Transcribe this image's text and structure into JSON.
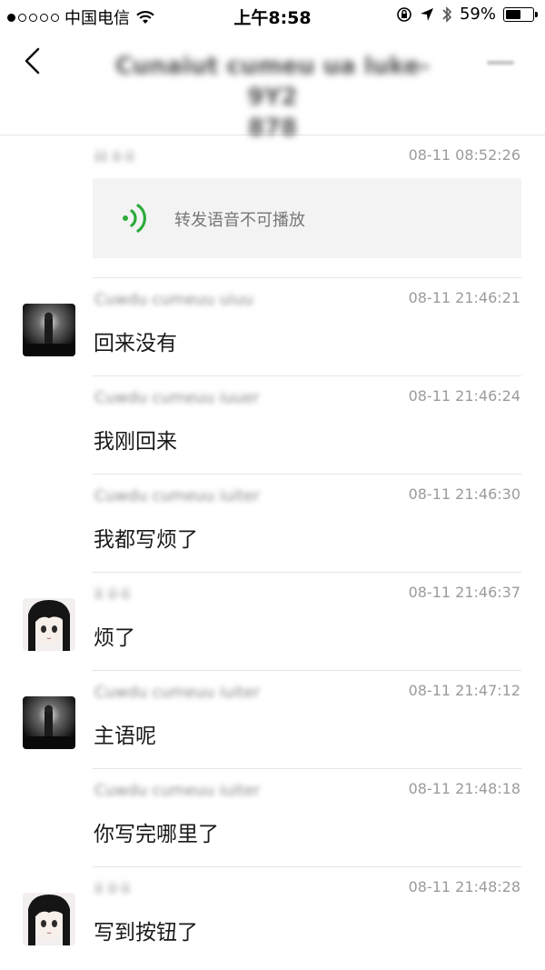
{
  "status_bar": {
    "signal_dots": 5,
    "signal_strength": 1,
    "carrier": "中国电信",
    "time": "上午8:58",
    "battery_text": "59%",
    "battery_level": 0.59,
    "icons": [
      "wifi-icon",
      "lock-rotation-icon",
      "location-arrow-icon",
      "bluetooth-icon",
      "battery-icon"
    ]
  },
  "header": {
    "title_line1": "Cunaiut cumeu ua luke-9Y2",
    "title_line2": "878",
    "back_icon": "chevron-left-icon",
    "more_icon": "more-icon"
  },
  "voice_message": {
    "sender": "iii ii·ii",
    "time": "08-11 08:52:26",
    "label": "转发语音不可播放",
    "icon": "voice-waves-icon",
    "icon_color": "#2bab3b"
  },
  "messages": [
    {
      "sender": "Cuwdu cumeuu uiuu",
      "time": "08-11 21:46:21",
      "text": "回来没有",
      "avatar": "dark"
    },
    {
      "sender": "Cuwdu cumeuu iuuer",
      "time": "08-11 21:46:24",
      "text": "我刚回来",
      "avatar": ""
    },
    {
      "sender": "Cuwdu cumeuu iuiter",
      "time": "08-11 21:46:30",
      "text": "我都写烦了",
      "avatar": ""
    },
    {
      "sender": "ii ii·ii",
      "time": "08-11 21:46:37",
      "text": "烦了",
      "avatar": "anime"
    },
    {
      "sender": "Cuwdu cumeuu iuiter",
      "time": "08-11 21:47:12",
      "text": "主语呢",
      "avatar": "dark"
    },
    {
      "sender": "Cuwdu cumeuu iuiter",
      "time": "08-11 21:48:18",
      "text": "你写完哪里了",
      "avatar": ""
    },
    {
      "sender": "ii ii·ii",
      "time": "08-11 21:48:28",
      "text": "写到按钮了",
      "avatar": "anime"
    }
  ]
}
